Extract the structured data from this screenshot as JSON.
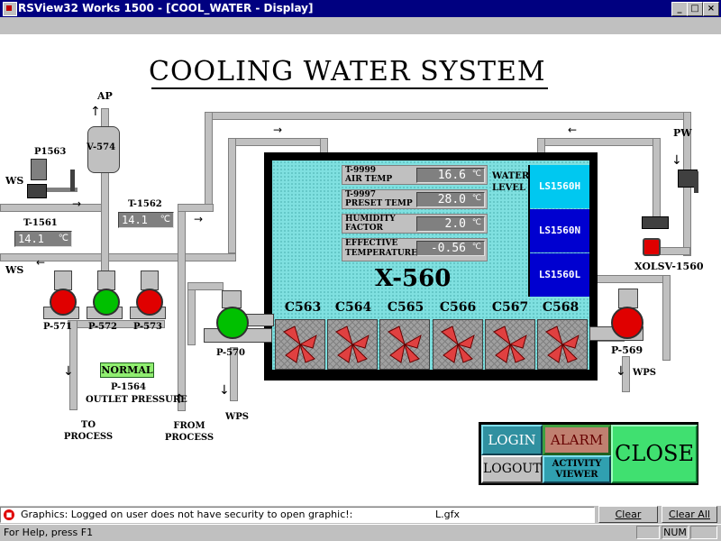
{
  "window": {
    "title": "RSView32 Works 1500   - [COOL_WATER - Display]",
    "min_btn": "_",
    "max_btn": "□",
    "close_btn": "×"
  },
  "display": {
    "title": "COOLING WATER SYSTEM",
    "tank": {
      "name": "X-560",
      "water_level_label": "WATER LEVEL",
      "level_switches": [
        {
          "label": "LS1560H",
          "color": "#00c8f0"
        },
        {
          "label": "LS1560N",
          "color": "#0000d0"
        },
        {
          "label": "LS1560L",
          "color": "#0000d0"
        }
      ],
      "readouts": [
        {
          "tag": "T-9999",
          "label": "AIR TEMP",
          "value": "16.6",
          "unit": "℃"
        },
        {
          "tag": "T-9997",
          "label": "PRESET TEMP",
          "value": "28.0",
          "unit": "℃"
        },
        {
          "tag": "HUMIDITY",
          "label": "FACTOR",
          "value": "2.0",
          "unit": "℃"
        },
        {
          "tag": "EFFECTIVE",
          "label": "TEMPERATURE",
          "value": "-0.56",
          "unit": "℃"
        }
      ],
      "coolers": [
        "C563",
        "C564",
        "C565",
        "C566",
        "C567",
        "C568"
      ]
    },
    "labels": {
      "ap": "AP",
      "pw": "PW",
      "ws_top": "WS",
      "ws_bottom": "WS",
      "p1563": "P1563",
      "v574": "V-574",
      "t1561": "T-1561",
      "t1562": "T-1562",
      "p571": "P-571",
      "p572": "P-572",
      "p573": "P-573",
      "p570": "P-570",
      "p569": "P-569",
      "valve": "XOLSV-1560",
      "wps1": "WPS",
      "wps2": "WPS",
      "to_process": "TO PROCESS",
      "from_process": "FROM PROCESS",
      "p1564": "P-1564",
      "outlet_pressure": "OUTLET PRESSURE"
    },
    "temps": {
      "t1561": "14.1",
      "t1562": "14.1",
      "unit": "℃"
    },
    "normal_badge": "NORMAL",
    "pump_colors": {
      "running": "#00c000",
      "stopped": "#e00000"
    },
    "controls": {
      "login": "LOGIN",
      "logout": "LOGOUT",
      "alarm": "ALARM",
      "activity_viewer": "ACTIVITY VIEWER",
      "close": "CLOSE"
    }
  },
  "status": {
    "message": "Graphics: Logged on user does not have security to open graphic!:",
    "file": "L.gfx",
    "clear": "Clear",
    "clear_all": "Clear All",
    "help": "For Help, press F1",
    "num": "NUM"
  }
}
